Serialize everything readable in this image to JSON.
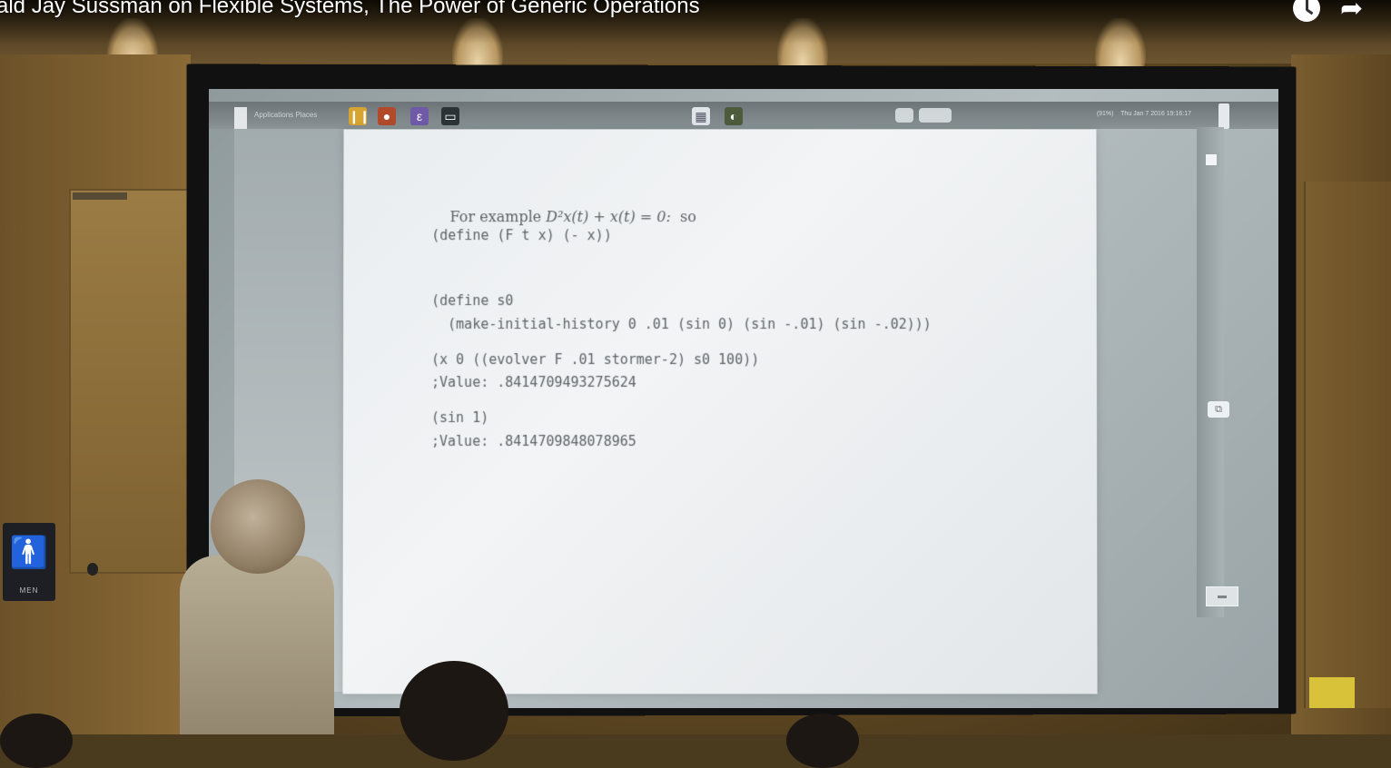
{
  "video": {
    "title": "ald Jay Sussman on Flexible Systems, The Power of Generic Operations",
    "watch_later_icon": "clock-icon",
    "share_icon": "share-arrow-icon"
  },
  "desktop_panel": {
    "left_menu": "Applications  Places",
    "datetime": "Thu Jan  7 2016 19:16:17",
    "battery": "(91%)"
  },
  "restroom_sign": {
    "icon": "restroom-icon",
    "label": "MEN"
  },
  "slide": {
    "intro_prefix": "For example ",
    "intro_math": "D²x(t) + x(t) = 0:",
    "intro_suffix": "  so",
    "lines": [
      "(define (F t x) (- x))",
      "(define s0",
      "  (make-initial-history 0 .01 (sin 0) (sin -.01) (sin -.02)))",
      "(x 0 ((evolver F .01 stormer-2) s0 100))",
      ";Value: .8414709493275624",
      "(sin 1)",
      ";Value: .8414709848078965"
    ]
  },
  "colors": {
    "slide_background": "#eef1f2",
    "slide_text": "#5d6367",
    "wall": "#7a5e30",
    "title_text": "#ffffff"
  }
}
